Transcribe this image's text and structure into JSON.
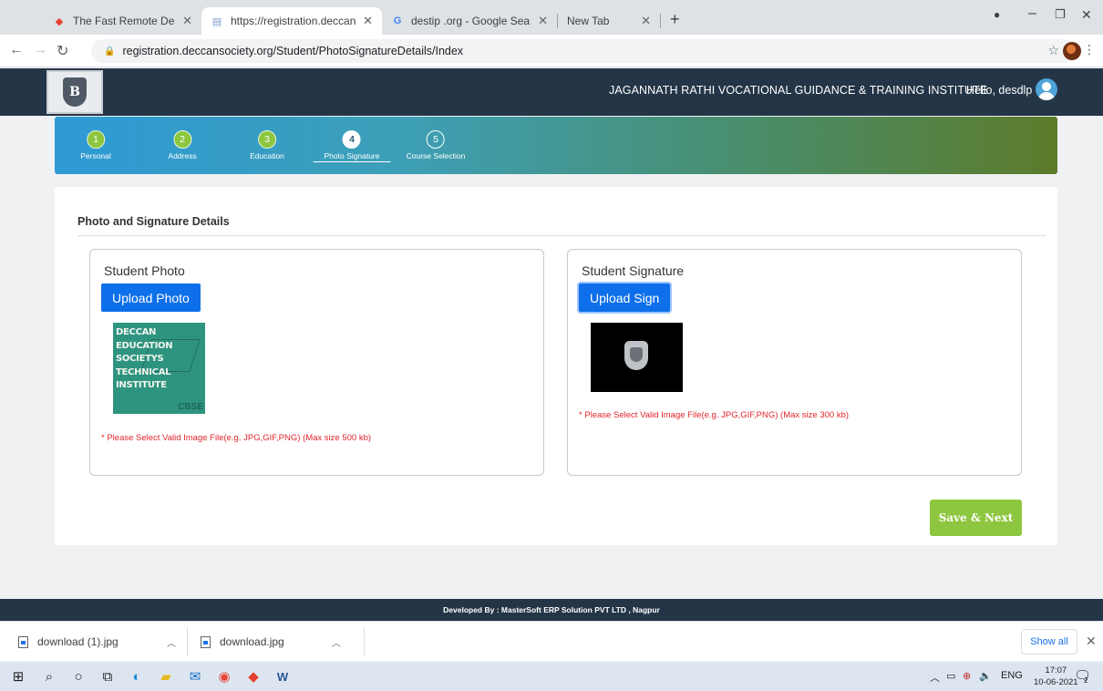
{
  "browser": {
    "tabs": [
      {
        "title": "The Fast Remote Desktop Applic",
        "icon": "anydesk-icon"
      },
      {
        "title": "https://registration.deccansociet",
        "icon": "page-icon"
      },
      {
        "title": "destip .org - Google Search",
        "icon": "google-icon"
      },
      {
        "title": "New Tab",
        "icon": ""
      }
    ],
    "url": "registration.deccansociety.org/Student/PhotoSignatureDetails/Index"
  },
  "site": {
    "institute": "JAGANNATH RATHI VOCATIONAL GUIDANCE & TRAINING INSTITUTE",
    "greeting": "Hello, desdlp",
    "logo_letter": "B"
  },
  "steps": [
    {
      "num": "1",
      "label": "Personal",
      "state": "done"
    },
    {
      "num": "2",
      "label": "Address",
      "state": "done"
    },
    {
      "num": "3",
      "label": "Education",
      "state": "done"
    },
    {
      "num": "4",
      "label": "Photo Signature",
      "state": "current"
    },
    {
      "num": "5",
      "label": "Course Selection",
      "state": "pending"
    }
  ],
  "form": {
    "section_title": "Photo and Signature Details",
    "photo": {
      "title": "Student Photo",
      "button": "Upload Photo",
      "image_lines": [
        "DECCAN",
        "EDUCATION",
        "SOCIETYS",
        "TECHNICAL",
        "INSTITUTE"
      ],
      "image_mark": "CBSE",
      "hint": "* Please Select Valid Image File(e.g. JPG,GIF,PNG) (Max size 500 kb)"
    },
    "signature": {
      "title": "Student Signature",
      "button": "Upload Sign",
      "hint": "* Please Select Valid Image File(e.g. JPG,GIF,PNG) (Max size 300 kb)"
    },
    "save_button": "Save & Next"
  },
  "footer": "Developed By : MasterSoft ERP Solution PVT LTD , Nagpur",
  "downloads": {
    "items": [
      "download (1).jpg",
      "download.jpg"
    ],
    "show_all": "Show all"
  },
  "taskbar": {
    "lang": "ENG",
    "time": "17:07",
    "date": "10-06-2021",
    "notifications": "2"
  },
  "colors": {
    "header": "#243547",
    "primary_button": "#0d6fea",
    "save_button": "#8dc63f",
    "error_text": "#e0262b"
  }
}
